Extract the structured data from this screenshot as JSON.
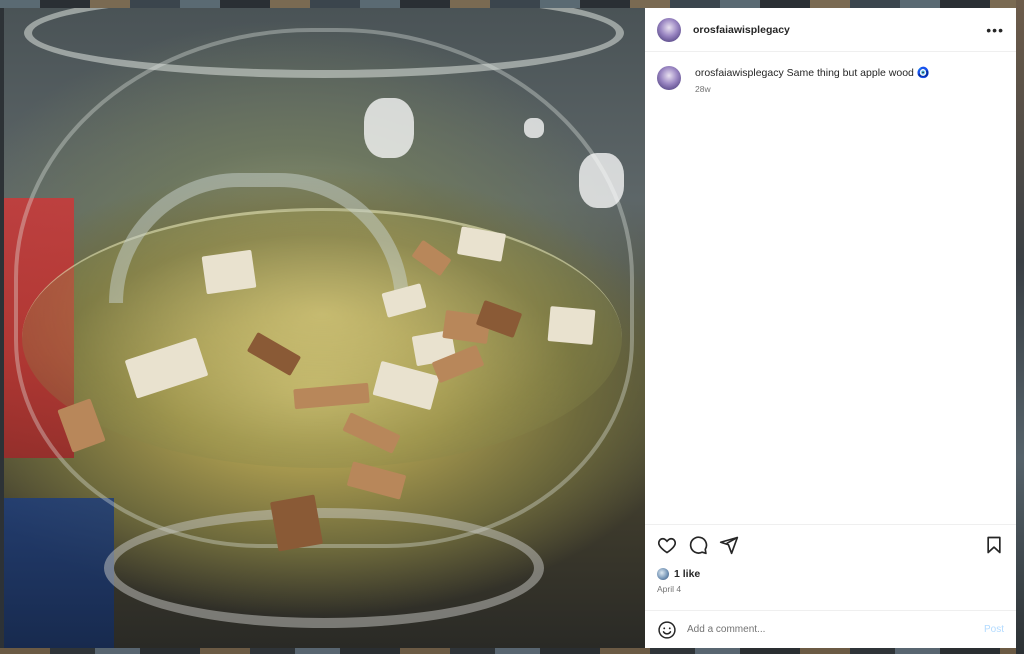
{
  "post": {
    "username": "orosfaiawisplegacy",
    "caption_text": "Same thing but apple wood",
    "caption_emoji": "🧿",
    "caption_time": "28w",
    "likes": "1 like",
    "date": "April 4"
  },
  "header": {
    "more_label": "•••"
  },
  "comment": {
    "placeholder": "Add a comment...",
    "post_label": "Post"
  },
  "icons": {
    "like": "heart-icon",
    "comment": "comment-icon",
    "share": "share-icon",
    "save": "bookmark-icon",
    "emoji": "emoji-icon"
  },
  "colors": {
    "text": "#262626",
    "secondary": "#737373",
    "post_button": "#b3dbff",
    "divider": "#efefef"
  }
}
